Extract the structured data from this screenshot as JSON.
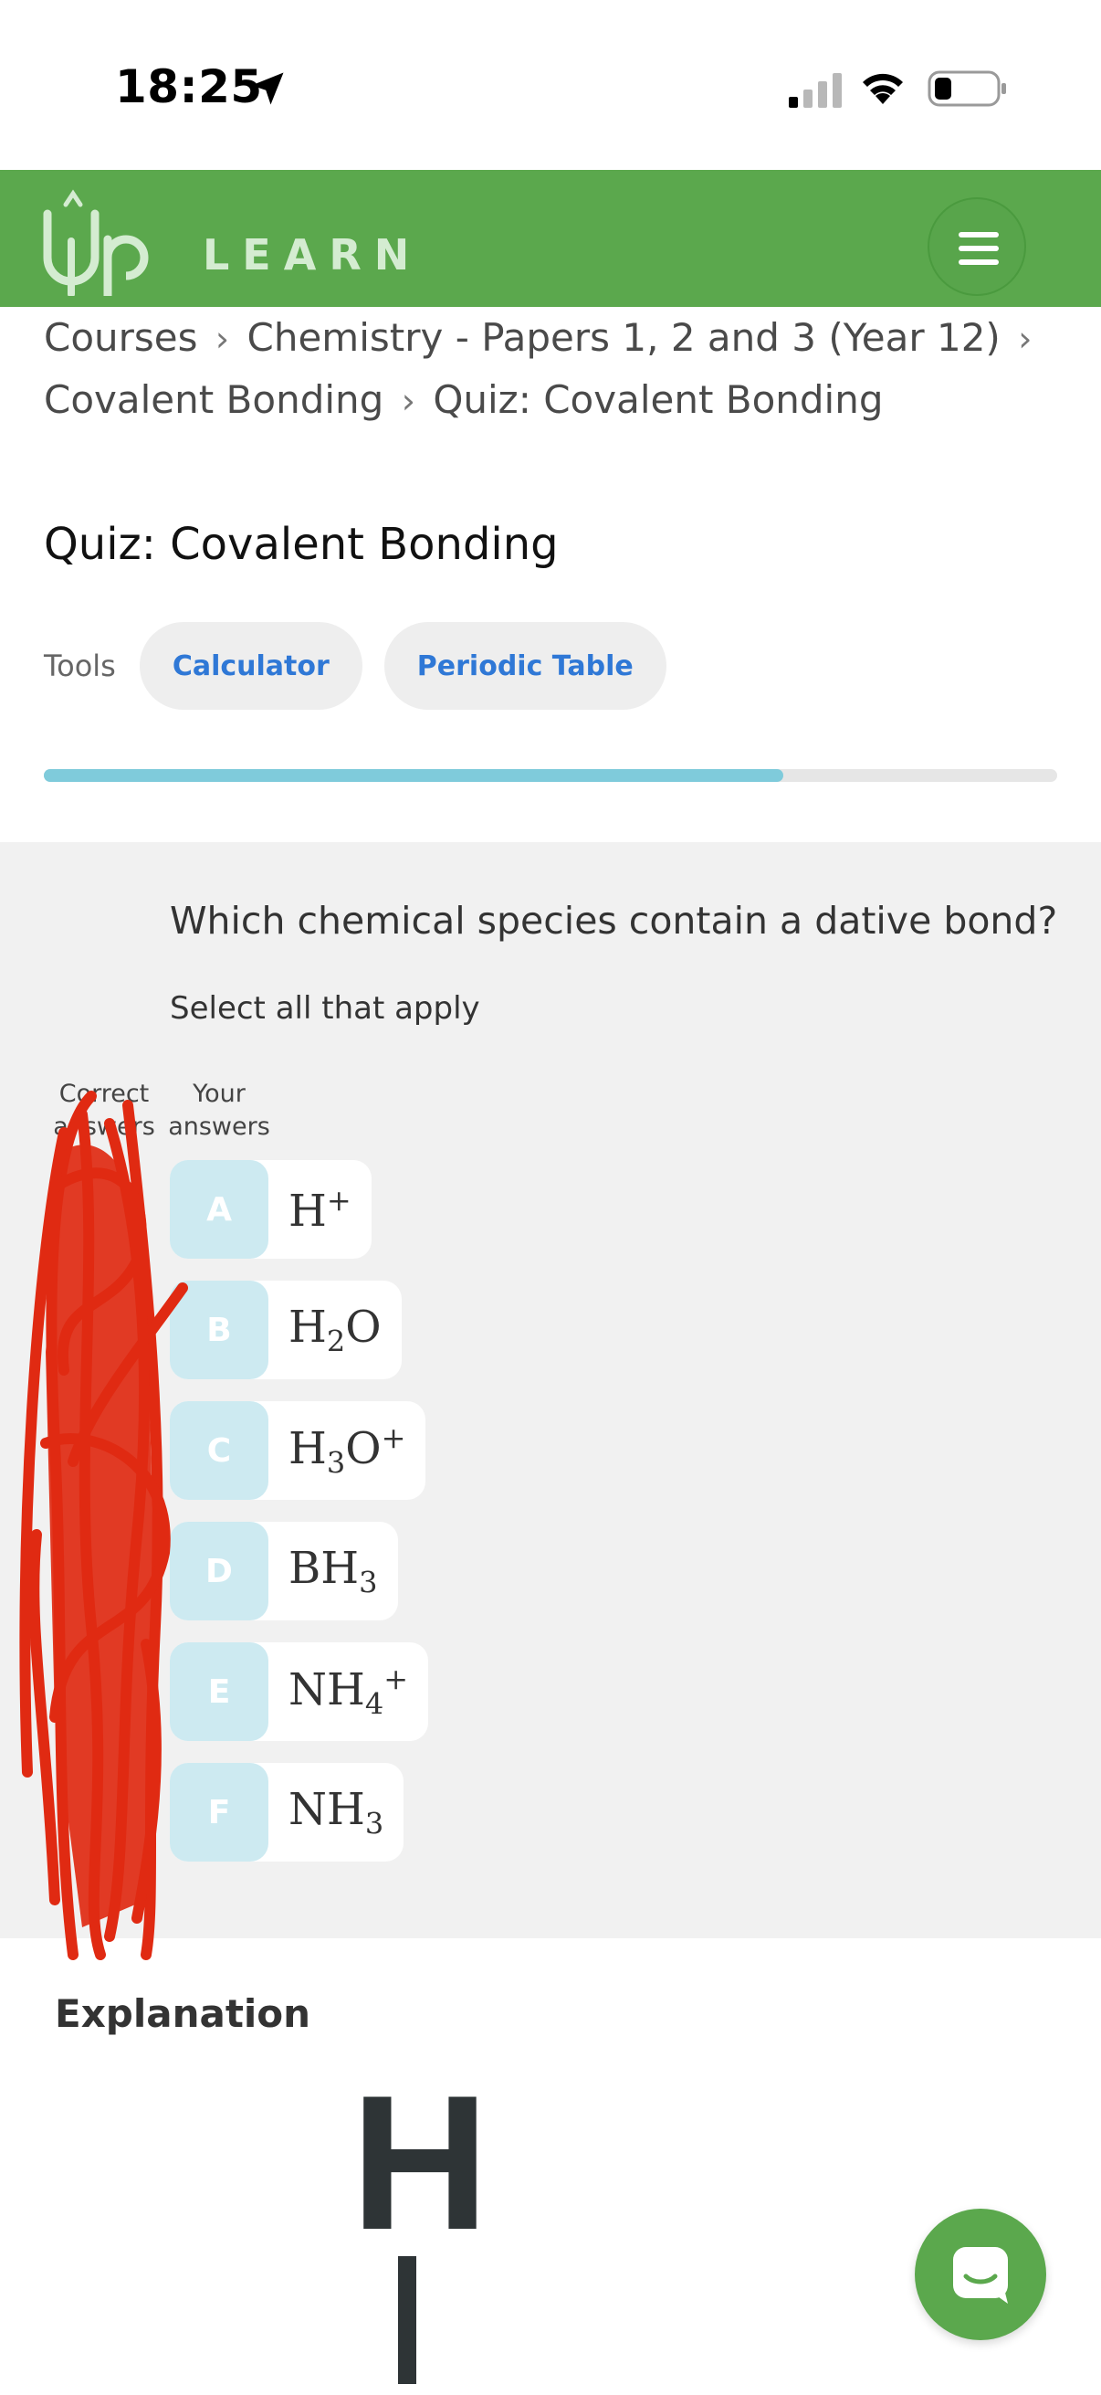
{
  "status_bar": {
    "time": "18:25"
  },
  "header": {
    "logo_text": "LEARN",
    "menu_icon": "hamburger-icon",
    "brand_color": "#5ba84d"
  },
  "breadcrumb": {
    "items": [
      "Courses",
      "Chemistry - Papers 1, 2 and 3 (Year 12)",
      "Covalent Bonding",
      "Quiz: Covalent Bonding"
    ],
    "separator": "›"
  },
  "page": {
    "title": "Quiz: Covalent Bonding"
  },
  "tools": {
    "label": "Tools",
    "buttons": [
      "Calculator",
      "Periodic Table"
    ]
  },
  "progress": {
    "fraction": 0.73
  },
  "question": {
    "text": "Which chemical species contain a dative bond?",
    "instruction": "Select all that apply",
    "columns": {
      "correct": "Correct answers",
      "yours": "Your answers"
    },
    "options": [
      {
        "letter": "A",
        "formula": "H",
        "sub": "",
        "sup": "+"
      },
      {
        "letter": "B",
        "formula": "H",
        "sub": "2",
        "tail": "O"
      },
      {
        "letter": "C",
        "formula": "H",
        "sub": "3",
        "tail": "O",
        "sup": "+"
      },
      {
        "letter": "D",
        "formula": "BH",
        "sub": "3"
      },
      {
        "letter": "E",
        "formula": "NH",
        "sub": "4",
        "sup": "+"
      },
      {
        "letter": "F",
        "formula": "NH",
        "sub": "3"
      }
    ]
  },
  "explanation": {
    "title": "Explanation",
    "molecule_atom": "H"
  },
  "chat": {
    "icon": "chat-bubble-icon"
  }
}
